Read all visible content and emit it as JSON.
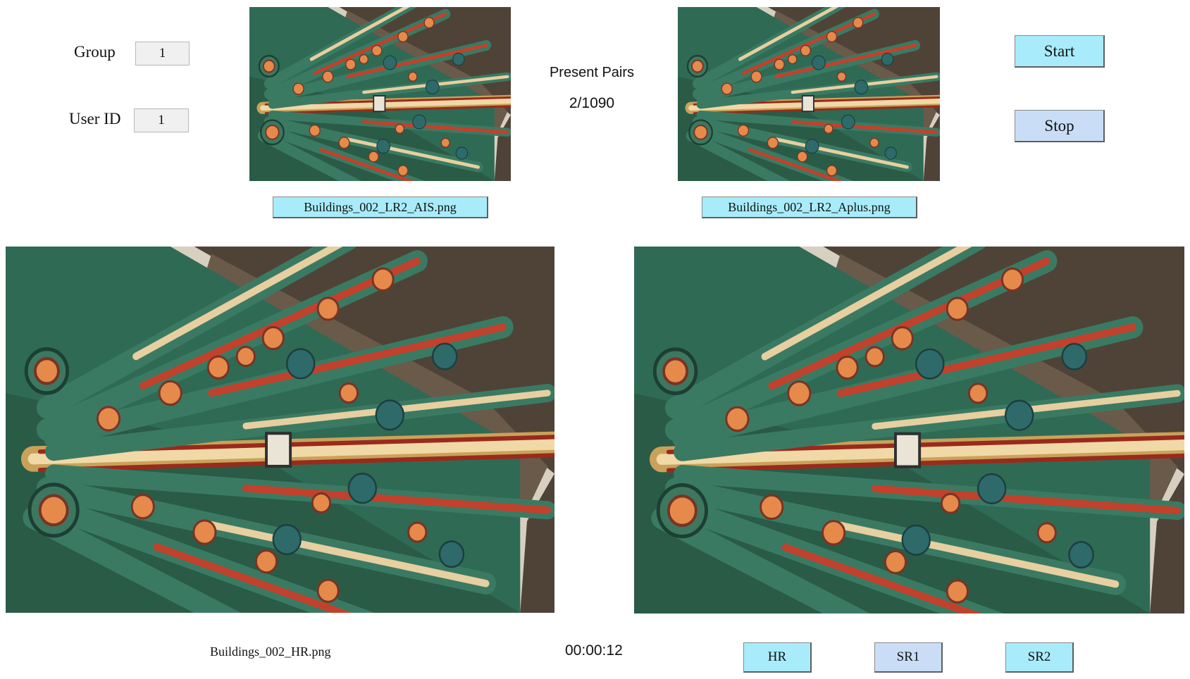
{
  "form": {
    "group_label": "Group",
    "group_value": "1",
    "userid_label": "User ID",
    "userid_value": "1"
  },
  "top_panel": {
    "present_label": "Present Pairs",
    "present_count": "2/1090",
    "left_file": "Buildings_002_LR2_AIS.png",
    "right_file": "Buildings_002_LR2_Aplus.png"
  },
  "controls": {
    "start_label": "Start",
    "stop_label": "Stop"
  },
  "bottom_panel": {
    "hr_file": "Buildings_002_HR.png",
    "timer": "00:00:12",
    "choice_buttons": [
      "HR",
      "SR1",
      "SR2"
    ]
  },
  "colors": {
    "button_cyan": "#a8ecfb",
    "button_lavender": "#c9def6",
    "textbox_bg": "#f0f0f0"
  },
  "icons": {
    "images": "photo-of-painted-roof-rafters"
  }
}
